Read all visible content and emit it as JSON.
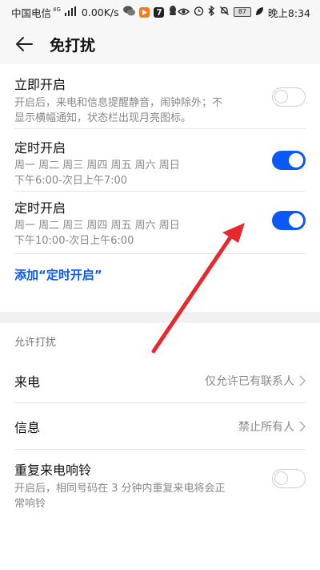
{
  "status_bar": {
    "carrier": "中国电信",
    "network_tag": "4G",
    "speed": "0.00K/s",
    "battery": "87",
    "time": "晚上8:34"
  },
  "toolbar": {
    "title": "免打扰"
  },
  "immediate": {
    "title": "立即开启",
    "desc_line1": "开启后，来电和信息提醒静音，闹钟除外；不",
    "desc_line2": "显示横幅通知，状态栏出现月亮图标。",
    "enabled": false
  },
  "schedules": [
    {
      "title": "定时开启",
      "days": "周一 周二 周三 周四 周五 周六 周日",
      "time": "下午6:00-次日上午7:00",
      "enabled": true
    },
    {
      "title": "定时开启",
      "days": "周一 周二 周三 周四 周五 周六 周日",
      "time": "下午10:00-次日上午6:00",
      "enabled": true
    }
  ],
  "add_schedule_label": "添加“定时开启”",
  "allow_section": {
    "header": "允许打扰",
    "calls": {
      "label": "来电",
      "value": "仅允许已有联系人"
    },
    "messages": {
      "label": "信息",
      "value": "禁止所有人"
    },
    "repeat_calls": {
      "title": "重复来电响铃",
      "desc_line1": "开启后，相同号码在 3 分钟内重复来电将会正",
      "desc_line2": "常响铃",
      "enabled": false
    }
  },
  "colors": {
    "accent": "#0a59f7",
    "annotation_arrow": "#e8282e"
  }
}
